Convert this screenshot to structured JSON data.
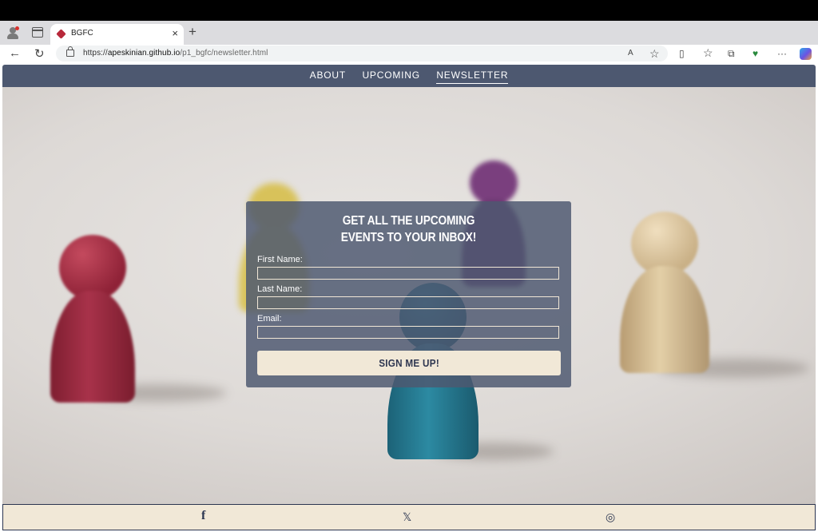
{
  "browser": {
    "tab_title": "BGFC",
    "tab_close": "×",
    "new_tab": "+",
    "url_scheme": "https://",
    "url_host": "apeskinian.github.io",
    "url_path": "/p1_bgfc/newsletter.html",
    "back_glyph": "←",
    "reload_glyph": "↻",
    "read_aloud_glyph": "A",
    "favorite_glyph": "☆",
    "split_glyph": "▯",
    "favorites_glyph": "☆",
    "collections_glyph": "⧉",
    "extension_glyph": "♥",
    "more_glyph": "···"
  },
  "nav": {
    "items": [
      "ABOUT",
      "UPCOMING",
      "NEWSLETTER"
    ]
  },
  "form": {
    "title_line1": "GET ALL THE UPCOMING",
    "title_line2": "EVENTS TO YOUR INBOX!",
    "first_name_label": "First Name:",
    "last_name_label": "Last Name:",
    "email_label": "Email:",
    "first_name_value": "",
    "last_name_value": "",
    "email_value": "",
    "submit_label": "SIGN ME UP!"
  },
  "footer": {
    "facebook_glyph": "f",
    "x_glyph": "𝕏",
    "instagram_glyph": "◎"
  },
  "colors": {
    "nav_bg": "#4d5870",
    "footer_bg": "#f1e8d7",
    "button_bg": "#f1e8d7",
    "button_text": "#2e3650"
  }
}
